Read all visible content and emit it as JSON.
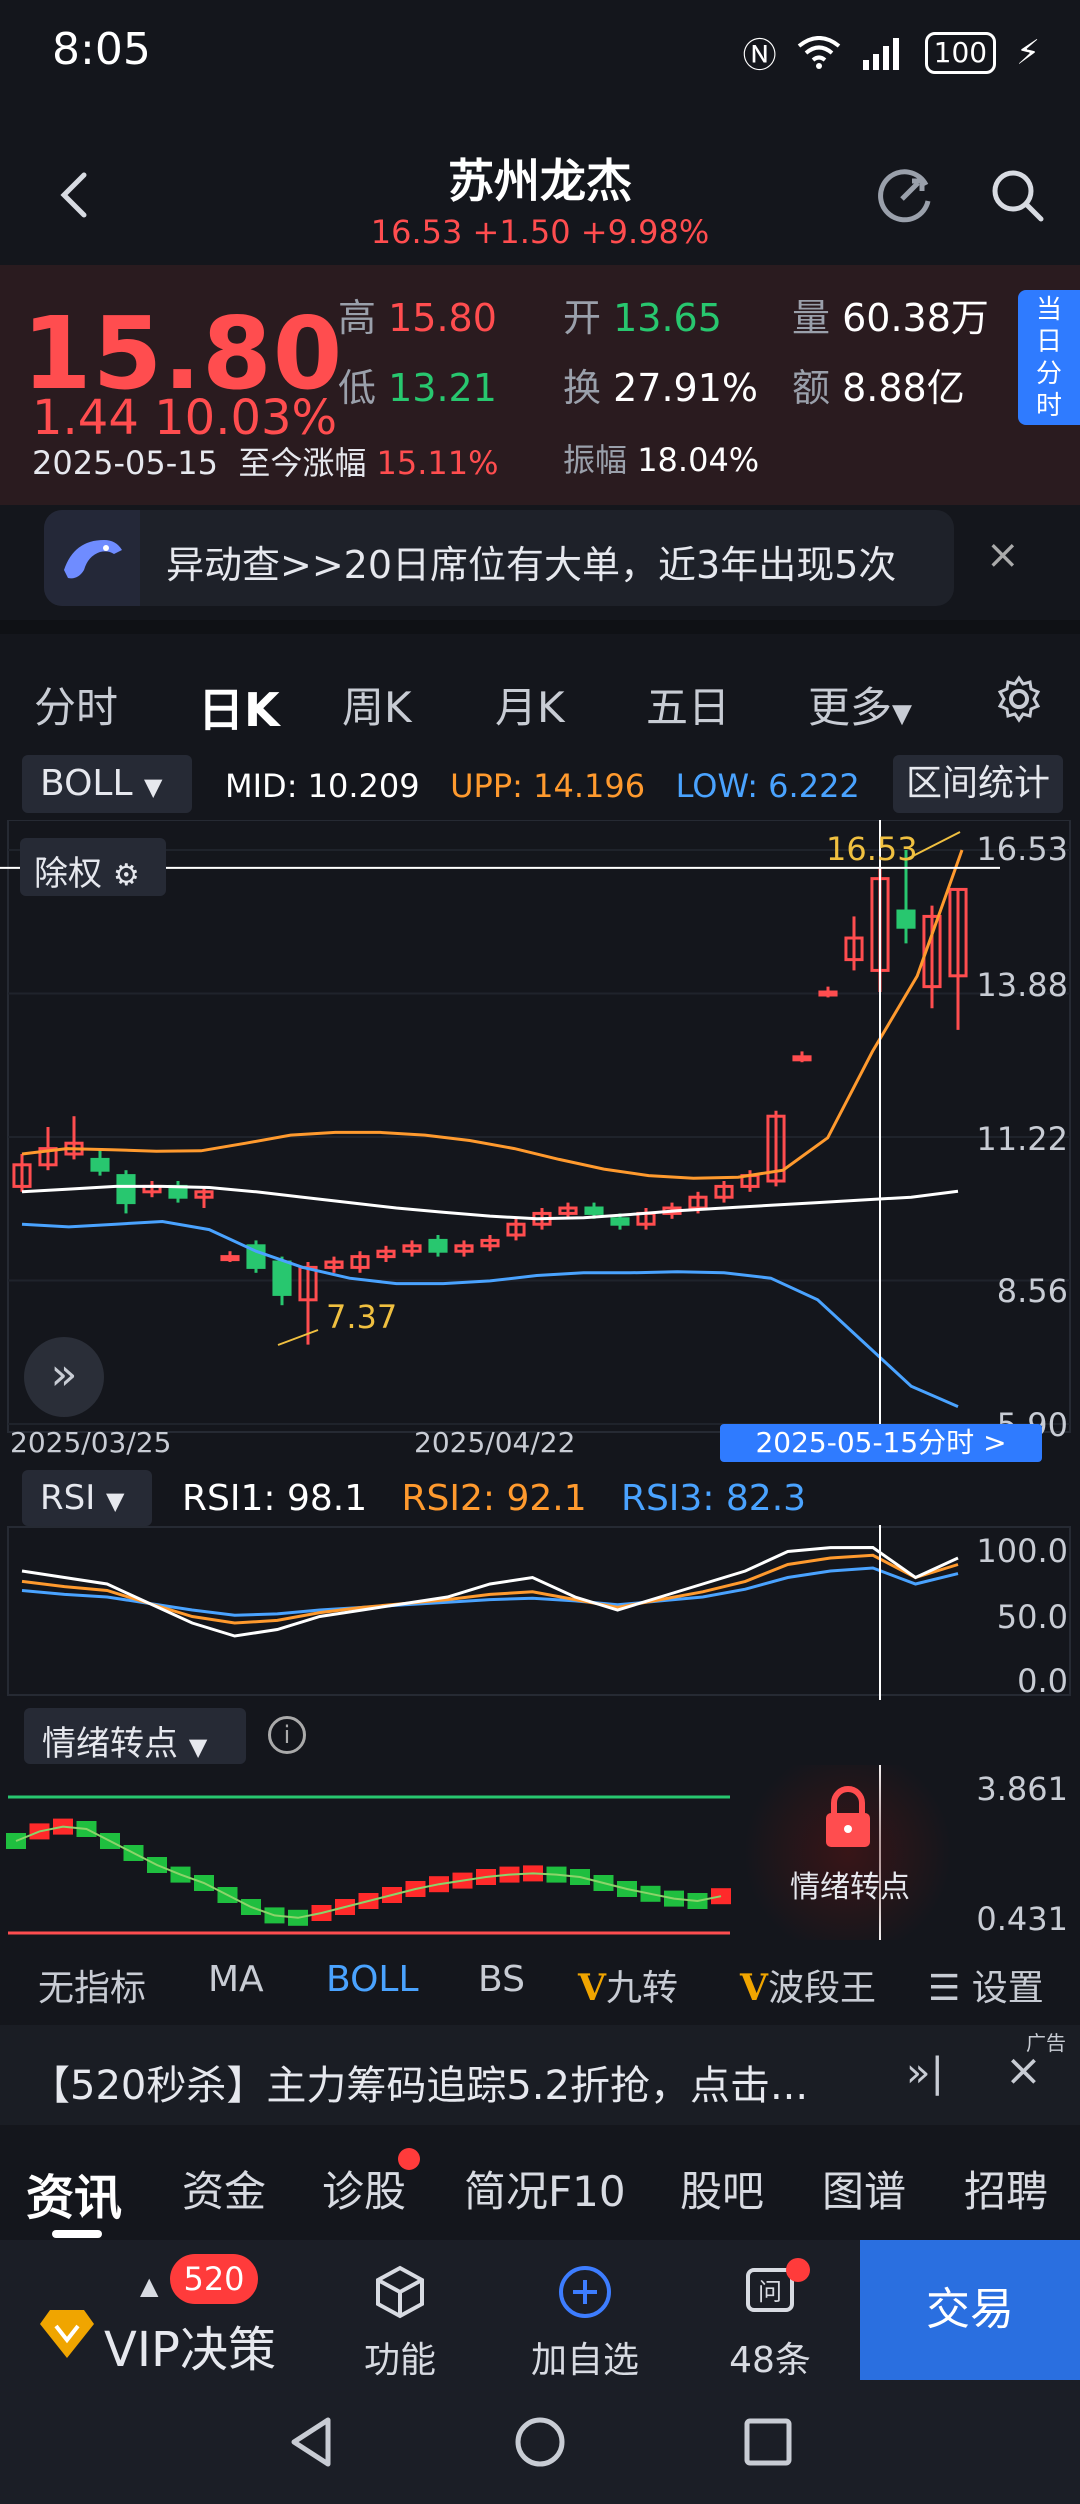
{
  "status_bar": {
    "time": "8:05",
    "battery": "100"
  },
  "header": {
    "title": "苏州龙杰",
    "subtitle": "16.53  +1.50  +9.98%"
  },
  "quote": {
    "price": "15.80",
    "change": "1.44  10.03%",
    "date_line_date": "2025-05-15",
    "date_line_label": "至今涨幅",
    "date_line_value": "15.11%",
    "high_label": "高",
    "high": "15.80",
    "open_label": "开",
    "open": "13.65",
    "volume_label": "量",
    "volume": "60.38万",
    "low_label": "低",
    "low": "13.21",
    "turnover_label": "换",
    "turnover": "27.91%",
    "amount_label": "额",
    "amount": "8.88亿",
    "amplitude_label": "振幅",
    "amplitude": "18.04%",
    "intraday_button": "当日分时"
  },
  "alert": {
    "text": "异动查>>20日席位有大单，近3年出现5次",
    "close": "×"
  },
  "tabs": [
    "分时",
    "日K",
    "周K",
    "月K",
    "五日",
    "更多"
  ],
  "boll": {
    "select": "BOLL",
    "mid_label": "MID:",
    "mid": "10.209",
    "upp_label": "UPP:",
    "upp": "14.196",
    "low_label": "LOW:",
    "low": "6.222",
    "range_button": "区间统计"
  },
  "kchart": {
    "fuquan_button": "除权",
    "y_ticks": [
      "16.53",
      "13.88",
      "11.22",
      "8.56",
      "5.90"
    ],
    "x_dates": [
      "2025/03/25",
      "2025/04/22"
    ],
    "crosshair_price": "16.53",
    "low_marker": "7.37",
    "crosshair_date": "2025-05-15分时  >"
  },
  "rsi": {
    "select": "RSI",
    "rsi1_label": "RSI1:",
    "rsi1": "98.1",
    "rsi2_label": "RSI2:",
    "rsi2": "92.1",
    "rsi3_label": "RSI3:",
    "rsi3": "82.3",
    "y_ticks": [
      "100.0",
      "50.0",
      "0.0"
    ]
  },
  "emotion": {
    "select": "情绪转点",
    "y_ticks": [
      "3.861",
      "0.431"
    ],
    "lock_label": "情绪转点"
  },
  "indicators": [
    "无指标",
    "MA",
    "BOLL",
    "BS",
    "九转",
    "波段王",
    "设置"
  ],
  "ad": {
    "text": "【520秒杀】主力筹码追踪5.2折抢，点击...",
    "tag": "广告"
  },
  "bottom_tabs": [
    "资讯",
    "资金",
    "诊股",
    "简况F10",
    "股吧",
    "图谱",
    "招聘"
  ],
  "actions": {
    "vip_badge": "520",
    "vip_label": "VIP决策",
    "function": "功能",
    "add_watch": "加自选",
    "questions": "48条",
    "trade": "交易"
  },
  "chart_data": {
    "type": "candlestick",
    "indicator": "BOLL",
    "ylim": [
      5.9,
      16.53
    ],
    "x_labels": [
      "2025/03/25",
      "2025/04/22"
    ],
    "candles": [
      {
        "o": 10.3,
        "c": 10.7,
        "h": 10.9,
        "l": 10.2,
        "up": true
      },
      {
        "o": 10.7,
        "c": 11.0,
        "h": 11.4,
        "l": 10.6,
        "up": true
      },
      {
        "o": 10.9,
        "c": 11.1,
        "h": 11.6,
        "l": 10.8,
        "up": true
      },
      {
        "o": 10.8,
        "c": 10.6,
        "h": 11.0,
        "l": 10.5,
        "up": false
      },
      {
        "o": 10.5,
        "c": 10.0,
        "h": 10.6,
        "l": 9.8,
        "up": false
      },
      {
        "o": 10.2,
        "c": 10.3,
        "h": 10.4,
        "l": 10.1,
        "up": true
      },
      {
        "o": 10.3,
        "c": 10.1,
        "h": 10.4,
        "l": 10.0,
        "up": false
      },
      {
        "o": 10.1,
        "c": 10.2,
        "h": 10.3,
        "l": 9.9,
        "up": true
      },
      {
        "o": 9.0,
        "c": 9.0,
        "h": 9.1,
        "l": 8.9,
        "up": true
      },
      {
        "o": 9.2,
        "c": 8.8,
        "h": 9.3,
        "l": 8.7,
        "up": false
      },
      {
        "o": 8.9,
        "c": 8.3,
        "h": 9.0,
        "l": 8.1,
        "up": false
      },
      {
        "o": 8.2,
        "c": 8.8,
        "h": 8.9,
        "l": 7.37,
        "up": true
      },
      {
        "o": 8.8,
        "c": 8.9,
        "h": 9.0,
        "l": 8.7,
        "up": true
      },
      {
        "o": 8.8,
        "c": 9.0,
        "h": 9.1,
        "l": 8.7,
        "up": true
      },
      {
        "o": 9.0,
        "c": 9.1,
        "h": 9.2,
        "l": 8.9,
        "up": true
      },
      {
        "o": 9.1,
        "c": 9.2,
        "h": 9.3,
        "l": 9.0,
        "up": true
      },
      {
        "o": 9.3,
        "c": 9.1,
        "h": 9.4,
        "l": 9.0,
        "up": false
      },
      {
        "o": 9.1,
        "c": 9.2,
        "h": 9.3,
        "l": 9.0,
        "up": true
      },
      {
        "o": 9.2,
        "c": 9.3,
        "h": 9.4,
        "l": 9.1,
        "up": true
      },
      {
        "o": 9.4,
        "c": 9.6,
        "h": 9.7,
        "l": 9.3,
        "up": true
      },
      {
        "o": 9.6,
        "c": 9.8,
        "h": 9.9,
        "l": 9.5,
        "up": true
      },
      {
        "o": 9.8,
        "c": 9.9,
        "h": 10.0,
        "l": 9.7,
        "up": true
      },
      {
        "o": 9.9,
        "c": 9.8,
        "h": 10.0,
        "l": 9.7,
        "up": false
      },
      {
        "o": 9.7,
        "c": 9.6,
        "h": 9.8,
        "l": 9.5,
        "up": false
      },
      {
        "o": 9.6,
        "c": 9.8,
        "h": 9.9,
        "l": 9.5,
        "up": true
      },
      {
        "o": 9.8,
        "c": 9.9,
        "h": 10.0,
        "l": 9.7,
        "up": true
      },
      {
        "o": 9.9,
        "c": 10.1,
        "h": 10.2,
        "l": 9.8,
        "up": true
      },
      {
        "o": 10.1,
        "c": 10.3,
        "h": 10.4,
        "l": 10.0,
        "up": true
      },
      {
        "o": 10.3,
        "c": 10.5,
        "h": 10.6,
        "l": 10.2,
        "up": true
      },
      {
        "o": 10.4,
        "c": 11.6,
        "h": 11.7,
        "l": 10.3,
        "up": true
      },
      {
        "o": 12.7,
        "c": 12.7,
        "h": 12.8,
        "l": 12.6,
        "up": true
      },
      {
        "o": 13.9,
        "c": 13.9,
        "h": 14.0,
        "l": 13.8,
        "up": true
      },
      {
        "o": 14.5,
        "c": 14.9,
        "h": 15.3,
        "l": 14.3,
        "up": true
      },
      {
        "o": 14.3,
        "c": 16.0,
        "h": 16.2,
        "l": 13.9,
        "up": true
      },
      {
        "o": 15.4,
        "c": 15.1,
        "h": 16.53,
        "l": 14.8,
        "up": false
      },
      {
        "o": 14.0,
        "c": 15.3,
        "h": 15.5,
        "l": 13.6,
        "up": true
      },
      {
        "o": 14.2,
        "c": 15.8,
        "h": 15.8,
        "l": 13.2,
        "up": true
      }
    ],
    "boll_mid": [
      10.2,
      10.25,
      10.3,
      10.3,
      10.28,
      10.2,
      10.1,
      10.0,
      9.9,
      9.82,
      9.75,
      9.7,
      9.72,
      9.78,
      9.85,
      9.9,
      9.95,
      10.0,
      10.05,
      10.1,
      10.209
    ],
    "boll_upp": [
      10.9,
      11.0,
      10.98,
      10.95,
      10.96,
      11.1,
      11.25,
      11.3,
      11.3,
      11.25,
      11.15,
      11.0,
      10.8,
      10.62,
      10.5,
      10.45,
      10.47,
      10.6,
      11.2,
      12.8,
      14.196,
      16.53
    ],
    "boll_low": [
      9.6,
      9.55,
      9.6,
      9.65,
      9.5,
      9.1,
      8.8,
      8.6,
      8.5,
      8.5,
      8.55,
      8.65,
      8.7,
      8.7,
      8.72,
      8.7,
      8.6,
      8.2,
      7.4,
      6.6,
      6.222
    ],
    "rsi": {
      "rsi1": [
        80,
        75,
        70,
        55,
        40,
        30,
        35,
        45,
        50,
        55,
        60,
        70,
        75,
        60,
        50,
        60,
        70,
        80,
        95,
        98,
        98.1,
        75,
        90
      ],
      "rsi2": [
        72,
        68,
        65,
        55,
        45,
        40,
        42,
        48,
        52,
        55,
        58,
        62,
        64,
        58,
        52,
        58,
        64,
        72,
        85,
        90,
        92.1,
        75,
        85
      ],
      "rsi3": [
        65,
        62,
        60,
        55,
        50,
        46,
        47,
        50,
        52,
        54,
        56,
        58,
        59,
        57,
        54,
        57,
        60,
        66,
        75,
        80,
        82.3,
        70,
        78
      ]
    }
  }
}
